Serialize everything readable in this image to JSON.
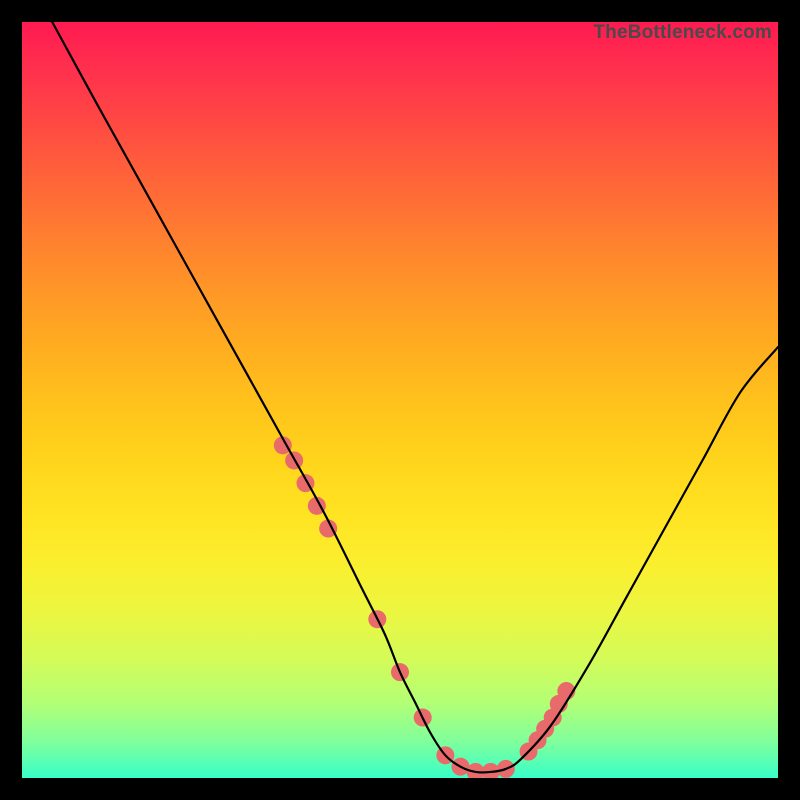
{
  "watermark": "TheBottleneck.com",
  "chart_data": {
    "type": "line",
    "title": "",
    "xlabel": "",
    "ylabel": "",
    "xlim": [
      0,
      100
    ],
    "ylim": [
      0,
      100
    ],
    "grid": false,
    "series": [
      {
        "name": "bottleneck-curve",
        "color": "#000000",
        "x": [
          4,
          10,
          15,
          20,
          25,
          30,
          35,
          40,
          45,
          48,
          50,
          52,
          54,
          56,
          58,
          60,
          62,
          64,
          66,
          70,
          75,
          80,
          85,
          90,
          95,
          100
        ],
        "y": [
          100,
          89,
          80,
          71,
          62,
          53,
          44,
          35,
          25,
          19,
          14,
          10,
          6,
          3,
          1.5,
          0.8,
          0.8,
          1.2,
          2.5,
          7,
          15,
          24,
          33,
          42,
          51,
          57
        ]
      }
    ],
    "markers": {
      "name": "highlight-dots",
      "color": "#e86a6a",
      "radius_px": 9,
      "x": [
        34.5,
        36,
        37.5,
        39,
        40.5,
        47,
        50,
        53,
        56,
        58,
        60,
        62,
        64,
        67,
        68.2,
        69.2,
        70.2,
        71,
        72
      ],
      "y": [
        44,
        42,
        39,
        36,
        33,
        21,
        14,
        8,
        3,
        1.5,
        0.8,
        0.8,
        1.2,
        3.5,
        5,
        6.5,
        8,
        9.8,
        11.5
      ]
    },
    "background_gradient": {
      "top": "#ff1a51",
      "bottom": "#38ffc8"
    }
  }
}
